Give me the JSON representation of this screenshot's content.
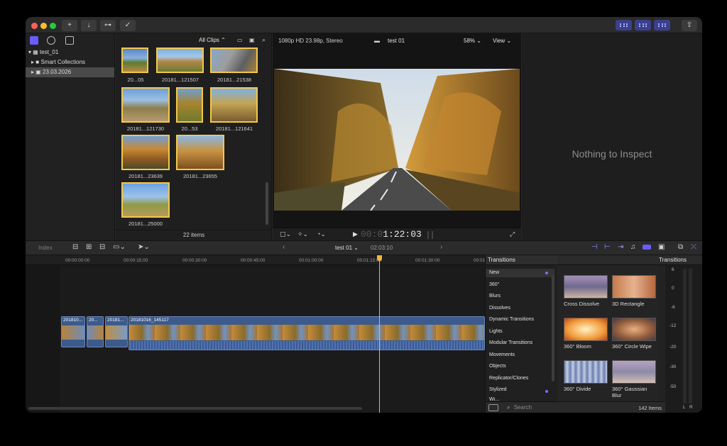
{
  "toolbar": {
    "key_icon_label": "⊶",
    "check_icon_label": "✓",
    "import_icon_label": "↓",
    "add_icon_label": "+",
    "share_icon_label": "⇪"
  },
  "library": {
    "project": "test_01",
    "items": [
      "Smart Collections",
      "23.03.2026"
    ]
  },
  "browser": {
    "filter": "All Clips",
    "count": "22 items",
    "clips": [
      "20...05",
      "20181...121507",
      "20181...21538",
      "20181...121730",
      "20...53",
      "20181...121641",
      "20181...23639",
      "20181...23655",
      "20181...25000"
    ]
  },
  "viewer": {
    "format": "1080p HD 23.98p, Stereo",
    "title": "test 01",
    "zoom": "58%",
    "view": "View",
    "timecode_dim": "00:0",
    "timecode": "1:22:03"
  },
  "inspector": {
    "empty": "Nothing to Inspect"
  },
  "timeline_bar": {
    "index": "Index",
    "project": "test 01",
    "duration": "02:03:10"
  },
  "timeline": {
    "ruler": [
      "00:00:00:00",
      "00:00:15:00",
      "00:00:30:00",
      "00:00:45:00",
      "00:01:00:00",
      "00:01:15:00",
      "00:01:30:00",
      "00:01:45:00"
    ],
    "clips": [
      "201810...",
      "20...",
      "20181...",
      "20181016_145117"
    ]
  },
  "transitions": {
    "title": "Transitions",
    "header_right": "Transitions",
    "categories": [
      "New",
      "360°",
      "Blurs",
      "Dissolves",
      "Dynamic Transitions",
      "Lights",
      "Modular Transitions",
      "Movements",
      "Objects",
      "Replicator/Clones",
      "Stylized",
      "Wi..."
    ],
    "items": [
      "Cross Dissolve",
      "3D Rectangle",
      "360° Bloom",
      "360° Circle Wipe",
      "360° Divide",
      "360° Gaussian Blur"
    ],
    "search_placeholder": "Search",
    "count": "142 Items"
  },
  "meters": {
    "labels": [
      "6",
      "0",
      "-6",
      "-12",
      "-20",
      "-30",
      "-50"
    ],
    "channels": [
      "L",
      "R"
    ]
  },
  "colors": {
    "accent": "#7d6cff",
    "playhead": "#f0b73d",
    "clip": "#3d5a8c",
    "selection": "#f2c84b"
  }
}
